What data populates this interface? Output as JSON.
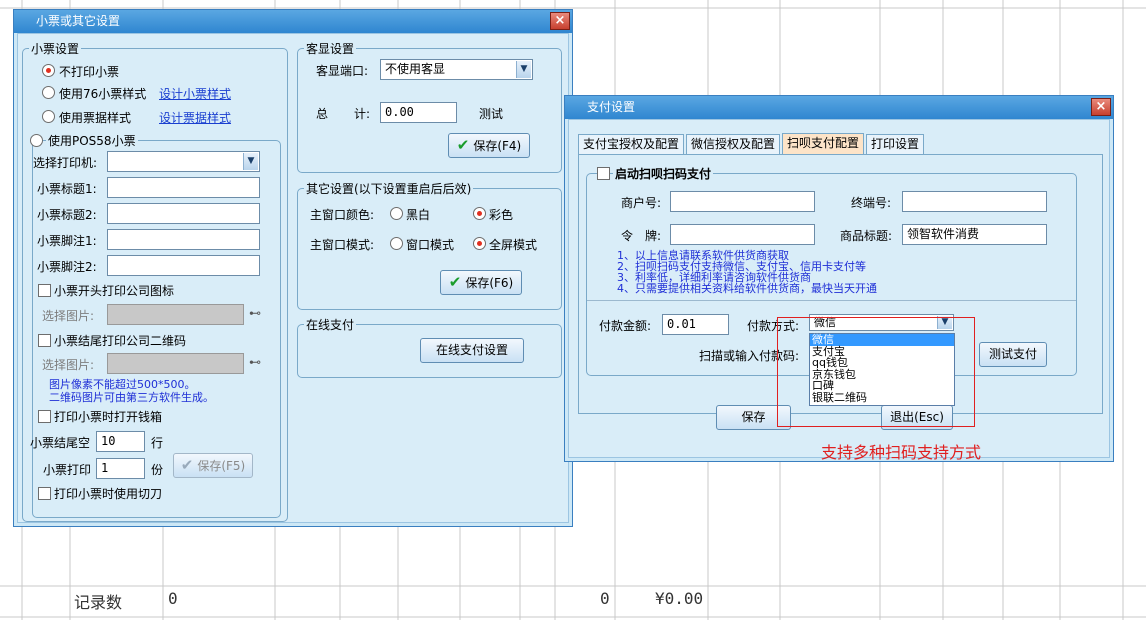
{
  "footer": {
    "records_label": "记录数",
    "records_value": "0",
    "count_value": "0",
    "amount_value": "¥0.00"
  },
  "receipt_window": {
    "title": "小票或其它设置",
    "close": "×",
    "receipt_group": {
      "title": "小票设置",
      "radio_no_print": "不打印小票",
      "radio_76": "使用76小票样式",
      "design_76_link": "设计小票样式",
      "radio_bill": "使用票据样式",
      "design_bill_link": "设计票据样式",
      "radio_pos58": "使用POS58小票",
      "printer_label": "选择打印机:",
      "title1_label": "小票标题1:",
      "title2_label": "小票标题2:",
      "footer1_label": "小票脚注1:",
      "footer2_label": "小票脚注2:",
      "logo_check": "小票开头打印公司图标",
      "select_image_label": "选择图片:",
      "qrcode_check": "小票结尾打印公司二维码",
      "select_image_label2": "选择图片:",
      "hint_line1": "图片像素不能超过500*500。",
      "hint_line2": "二维码图片可由第三方软件生成。",
      "cash_drawer_check": "打印小票时打开钱箱",
      "end_blank_label": "小票结尾空",
      "end_blank_value": "10",
      "lines_unit": "行",
      "copies_label": "小票打印",
      "copies_value": "1",
      "copies_unit": "份",
      "save_button": "保存(F5)",
      "cutter_check": "打印小票时使用切刀"
    },
    "display_group": {
      "title": "客显设置",
      "port_label": "客显端口:",
      "port_value": "不使用客显",
      "total_label_1": "总",
      "total_label_2": "计:",
      "total_value": "0.00",
      "test_label": "测试",
      "save_button": "保存(F4)"
    },
    "other_group": {
      "title": "其它设置(以下设置重启后后效)",
      "color_label": "主窗口颜色:",
      "color_bw": "黑白",
      "color_color": "彩色",
      "mode_label": "主窗口模式:",
      "mode_window": "窗口模式",
      "mode_full": "全屏模式",
      "save_button": "保存(F6)"
    },
    "online_group": {
      "title": "在线支付",
      "settings_button": "在线支付设置"
    }
  },
  "pay_window": {
    "title": "支付设置",
    "close": "×",
    "tabs": [
      "支付宝授权及配置",
      "微信授权及配置",
      "扫呗支付配置",
      "打印设置"
    ],
    "active_tab": 2,
    "enable_check": "启动扫呗扫码支付",
    "merchant_label": "商户号:",
    "terminal_label": "终端号:",
    "token_label_1": "令",
    "token_label_2": "牌:",
    "product_label": "商品标题:",
    "product_value": "领智软件消费",
    "notes": [
      "1、以上信息请联系软件供货商获取",
      "2、扫呗扫码支付支持微信、支付宝、信用卡支付等",
      "3、利率低，详细利率请咨询软件供货商",
      "4、只需要提供相关资料给软件供货商，最快当天开通"
    ],
    "amount_label": "付款金额:",
    "amount_value": "0.01",
    "method_label": "付款方式:",
    "method_value": "微信",
    "methods": [
      "微信",
      "支付宝",
      "qq钱包",
      "京东钱包",
      "口碑",
      "银联二维码"
    ],
    "scan_label": "扫描或输入付款码:",
    "test_button": "测试支付",
    "save_button": "保存",
    "exit_button": "退出(Esc)",
    "annotation": "支持多种扫码支持方式"
  },
  "colors": {
    "title_bar": "#2f86d0",
    "window_bg": "#d9edf8",
    "link": "#1a3fd0",
    "hint": "#1f2fd6",
    "annotation": "#e02020",
    "selection": "#3399ff"
  }
}
